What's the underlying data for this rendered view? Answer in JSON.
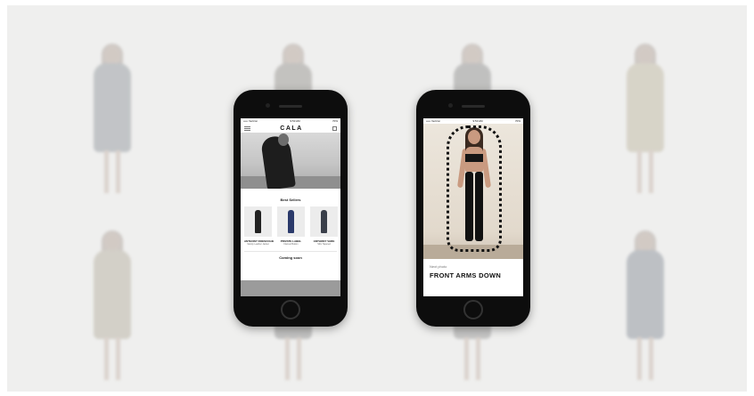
{
  "left_phone": {
    "status": {
      "carrier": "••••• Verizon",
      "time": "9:53 AM",
      "battery": "70%"
    },
    "app_logo": "CALA",
    "section_title": "Best Sellers",
    "products": [
      {
        "name": "ANTHONY DOESCOLIE",
        "desc": "Varsity Leather Jacket"
      },
      {
        "name": "PRIVATE LABEL",
        "desc": "Flannel Button"
      },
      {
        "name": "ANTHONY VARE",
        "desc": "Slim Tapered"
      }
    ],
    "coming_soon": "Coming soon"
  },
  "right_phone": {
    "status": {
      "carrier": "••••• Verizon",
      "time": "9:53 AM",
      "battery": "70%"
    },
    "caption_small": "Next photo",
    "caption_big": "FRONT ARMS DOWN"
  },
  "background_figures": 8,
  "colors": {
    "background": "#efefee",
    "phone_body": "#0d0d0d",
    "accent": "#111111"
  }
}
